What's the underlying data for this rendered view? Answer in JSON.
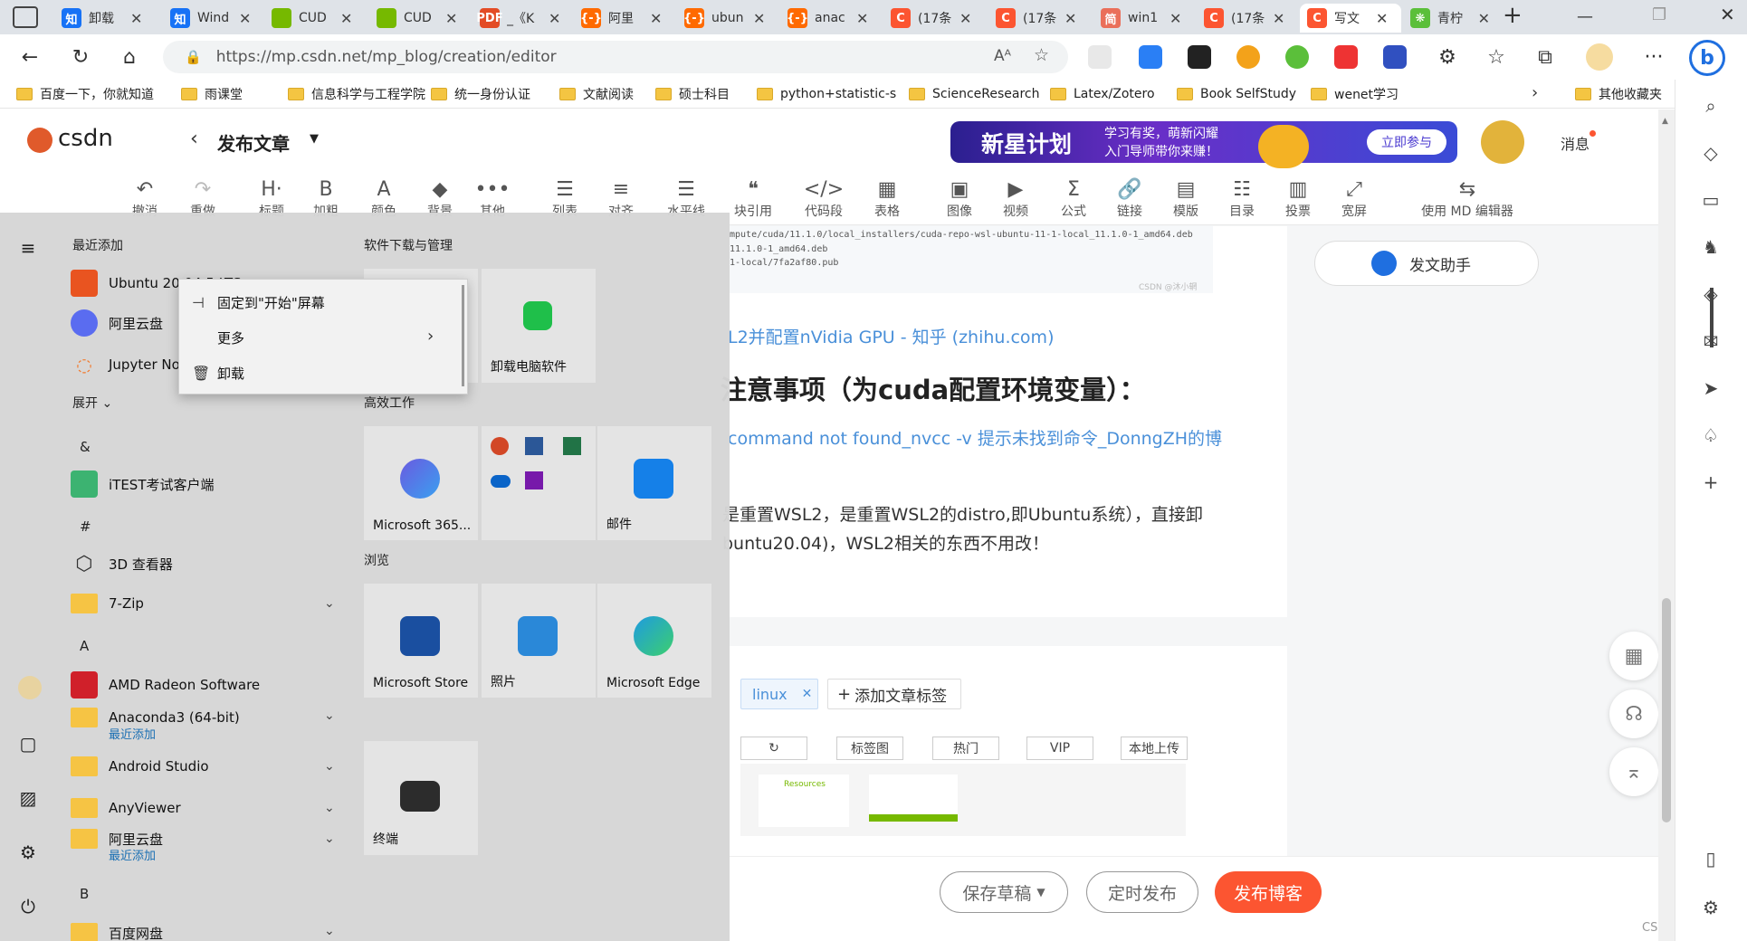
{
  "tabs": [
    {
      "label": "卸载",
      "fav": "知",
      "color": "#1772f6"
    },
    {
      "label": "Wind",
      "fav": "知",
      "color": "#1772f6"
    },
    {
      "label": "CUD",
      "fav": "",
      "color": "#76b900"
    },
    {
      "label": "CUD",
      "fav": "",
      "color": "#76b900"
    },
    {
      "label": "_《K",
      "fav": "PDF",
      "color": "#e34c26"
    },
    {
      "label": "阿里",
      "fav": "{-}",
      "color": "#ff6a00"
    },
    {
      "label": "ubun",
      "fav": "{-}",
      "color": "#ff6a00"
    },
    {
      "label": "anac",
      "fav": "{-}",
      "color": "#ff6a00"
    },
    {
      "label": "(17条",
      "fav": "C",
      "color": "#fc5531"
    },
    {
      "label": "(17条",
      "fav": "C",
      "color": "#fc5531"
    },
    {
      "label": "win1",
      "fav": "简",
      "color": "#ea6f5a"
    },
    {
      "label": "(17条",
      "fav": "C",
      "color": "#fc5531"
    },
    {
      "label": "写文",
      "fav": "C",
      "color": "#fc5531"
    },
    {
      "label": "青柠",
      "fav": "❋",
      "color": "#5bbf3a"
    }
  ],
  "address": {
    "url": "https://mp.csdn.net/mp_blog/creation/editor"
  },
  "bookmarks": [
    "百度一下，你就知道",
    "雨课堂",
    "信息科学与工程学院",
    "统一身份认证",
    "文献阅读",
    "硕士科目",
    "python+statistic-s",
    "ScienceResearch",
    "Latex/Zotero",
    "Book SelfStudy",
    "wenet学习",
    "其他收藏夹"
  ],
  "csdn": {
    "logo": "csdn",
    "publish_title": "发布文章",
    "banner_main": "新星计划",
    "banner_sub1": "学习有奖，萌新闪耀",
    "banner_sub2": "入门导师带你来赚！",
    "banner_btn": "立即参与",
    "messages": "消息"
  },
  "toolbar": [
    {
      "label": "撤消",
      "icon": "↶"
    },
    {
      "label": "重做",
      "icon": "↷"
    },
    {
      "label": "标题",
      "icon": "H·"
    },
    {
      "label": "加粗",
      "icon": "B"
    },
    {
      "label": "颜色",
      "icon": "A"
    },
    {
      "label": "背景",
      "icon": "◆"
    },
    {
      "label": "其他",
      "icon": "•••"
    },
    {
      "label": "列表",
      "icon": "☰"
    },
    {
      "label": "对齐",
      "icon": "≡"
    },
    {
      "label": "水平线",
      "icon": "☰"
    },
    {
      "label": "块引用",
      "icon": "❝"
    },
    {
      "label": "代码段",
      "icon": "</>"
    },
    {
      "label": "表格",
      "icon": "▦"
    },
    {
      "label": "图像",
      "icon": "▣"
    },
    {
      "label": "视频",
      "icon": "▶"
    },
    {
      "label": "公式",
      "icon": "Σ"
    },
    {
      "label": "链接",
      "icon": "🔗"
    },
    {
      "label": "模版",
      "icon": "▤"
    },
    {
      "label": "目录",
      "icon": "☷"
    },
    {
      "label": "投票",
      "icon": "▥"
    },
    {
      "label": "宽屏",
      "icon": "⤢"
    },
    {
      "label": "使用 MD 编辑器",
      "icon": "⇆"
    }
  ],
  "editor": {
    "code_line1": "mpute/cuda/11.1.0/local_installers/cuda-repo-wsl-ubuntu-11-1-local_11.1.0-1_amd64.deb",
    "code_line2": "11.1.0-1_amd64.deb",
    "code_line3": "1-local/7fa2af80.pub",
    "code_watermark": "CSDN @沐小辋",
    "link1": "L2并配置nVidia GPU - 知乎 (zhihu.com)",
    "heading": "注意事项（为cuda配置环境变量）：",
    "link2": "command not found_nvcc -v 提示未找到命令_DonngZH的博",
    "para1": "是重置WSL2，是重置WSL2的distro,即Ubuntu系统），直接卸",
    "para2": "buntu20.04)，WSL2相关的东西不用改！",
    "assistant": "发文助手",
    "tag": "linux",
    "add_tag": "添加文章标签",
    "img_tabs": [
      "↻",
      "标签图",
      "热门",
      "VIP",
      "本地上传"
    ],
    "thumb1_title": "Resources",
    "save_draft": "保存草稿",
    "schedule": "定时发布",
    "publish": "发布博客",
    "watermark": "CSDN @沐小辋"
  },
  "start_menu": {
    "recent_header": "最近添加",
    "apps_recent": [
      "Ubuntu 20.04.5 LTS",
      "阿里云盘",
      "Jupyter Notebook"
    ],
    "expand": "展开",
    "groups": [
      {
        "letter": "&",
        "apps": [
          {
            "name": "iTEST考试客户端"
          }
        ]
      },
      {
        "letter": "#",
        "apps": [
          {
            "name": "3D 查看器"
          },
          {
            "name": "7-Zip"
          }
        ]
      },
      {
        "letter": "A",
        "apps": [
          {
            "name": "AMD Radeon Software"
          },
          {
            "name": "Anaconda3 (64-bit)",
            "sub": "最近添加"
          },
          {
            "name": "Android Studio"
          },
          {
            "name": "AnyViewer"
          },
          {
            "name": "阿里云盘",
            "sub": "最近添加"
          }
        ]
      },
      {
        "letter": "B",
        "apps": [
          {
            "name": "百度网盘"
          }
        ]
      }
    ],
    "tile_groups": [
      "软件下载与管理",
      "高效工作",
      "浏览"
    ],
    "tiles": [
      "卸载电脑软件",
      "Microsoft 365...",
      "邮件",
      "Microsoft Store",
      "照片",
      "Microsoft Edge",
      "终端"
    ],
    "context_menu": [
      "固定到\"开始\"屏幕",
      "更多",
      "卸载"
    ]
  }
}
